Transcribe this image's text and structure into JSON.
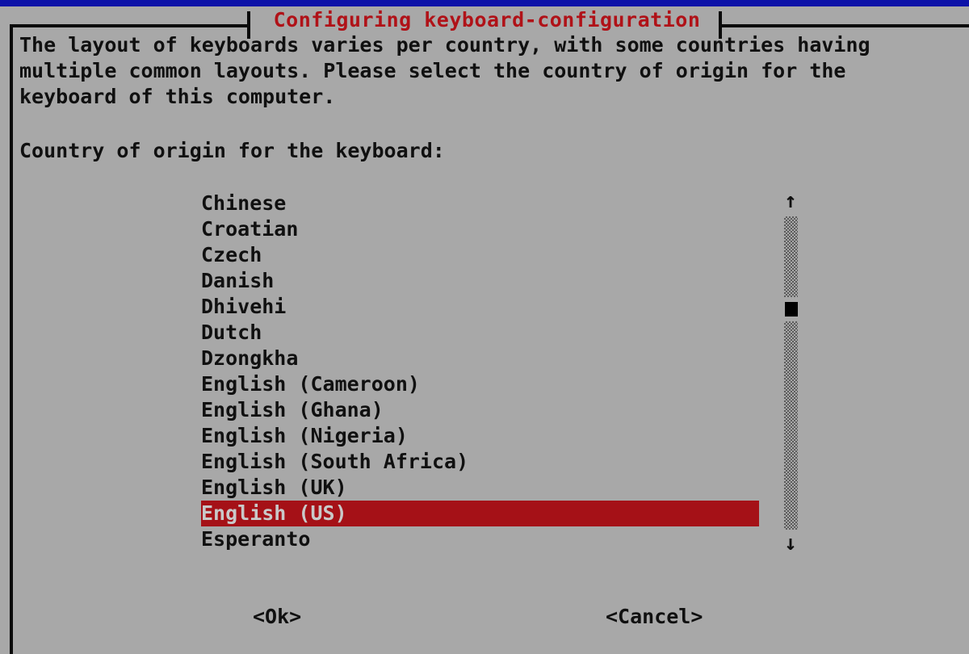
{
  "window": {
    "title": "Configuring keyboard-configuration",
    "title_color": "#b01218",
    "background_color": "#a8a8a8",
    "border_color": "#0a0a0a",
    "backdrop_color": "#0c12a8"
  },
  "prose": {
    "line1": "The layout of keyboards varies per country, with some countries having",
    "line2": "multiple common layouts. Please select the country of origin for the",
    "line3": "keyboard of this computer."
  },
  "prompt": {
    "label": "Country of origin for the keyboard:"
  },
  "list": {
    "selected_index": 12,
    "selected_value": "English (US)",
    "selection_bg": "#a51117",
    "selection_fg": "#c9c9c9",
    "items": [
      {
        "label": "Chinese"
      },
      {
        "label": "Croatian"
      },
      {
        "label": "Czech"
      },
      {
        "label": "Danish"
      },
      {
        "label": "Dhivehi"
      },
      {
        "label": "Dutch"
      },
      {
        "label": "Dzongkha"
      },
      {
        "label": "English (Cameroon)"
      },
      {
        "label": "English (Ghana)"
      },
      {
        "label": "English (Nigeria)"
      },
      {
        "label": "English (South Africa)"
      },
      {
        "label": "English (UK)"
      },
      {
        "label": "English (US)"
      },
      {
        "label": "Esperanto"
      }
    ]
  },
  "scrollbar": {
    "up_arrow": "↑",
    "down_arrow": "↓",
    "thumb_color": "#000000",
    "track_color": "#5d5d5d"
  },
  "buttons": {
    "ok": "<Ok>",
    "cancel": "<Cancel>"
  }
}
